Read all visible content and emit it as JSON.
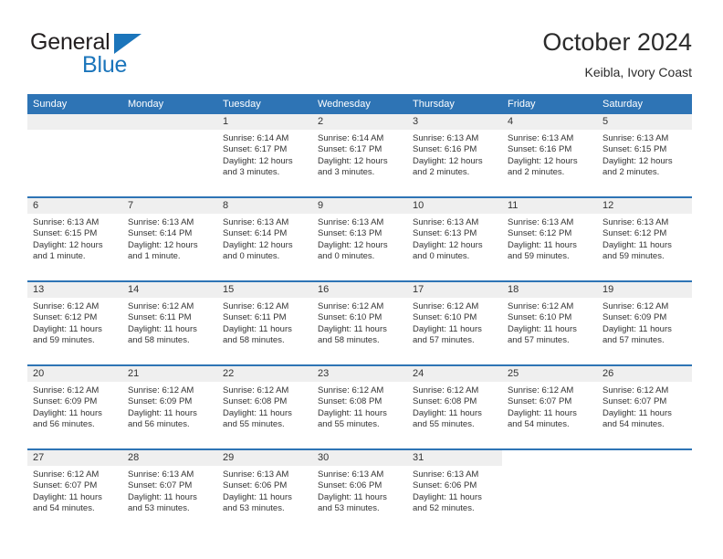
{
  "brand": {
    "name_part1": "General",
    "name_part2": "Blue",
    "triangle_icon": "triangle-icon",
    "accent_color": "#1b75bb"
  },
  "header": {
    "title": "October 2024",
    "subtitle": "Keibla, Ivory Coast"
  },
  "theme": {
    "header_blue": "#2e74b5",
    "daynum_gray": "#efefef",
    "text": "#333333"
  },
  "weekdays": [
    "Sunday",
    "Monday",
    "Tuesday",
    "Wednesday",
    "Thursday",
    "Friday",
    "Saturday"
  ],
  "weeks": [
    {
      "days": [
        {
          "num": "",
          "blank": true,
          "lines": []
        },
        {
          "num": "",
          "blank": true,
          "lines": []
        },
        {
          "num": "1",
          "lines": [
            "Sunrise: 6:14 AM",
            "Sunset: 6:17 PM",
            "Daylight: 12 hours and 3 minutes."
          ]
        },
        {
          "num": "2",
          "lines": [
            "Sunrise: 6:14 AM",
            "Sunset: 6:17 PM",
            "Daylight: 12 hours and 3 minutes."
          ]
        },
        {
          "num": "3",
          "lines": [
            "Sunrise: 6:13 AM",
            "Sunset: 6:16 PM",
            "Daylight: 12 hours and 2 minutes."
          ]
        },
        {
          "num": "4",
          "lines": [
            "Sunrise: 6:13 AM",
            "Sunset: 6:16 PM",
            "Daylight: 12 hours and 2 minutes."
          ]
        },
        {
          "num": "5",
          "lines": [
            "Sunrise: 6:13 AM",
            "Sunset: 6:15 PM",
            "Daylight: 12 hours and 2 minutes."
          ]
        }
      ]
    },
    {
      "days": [
        {
          "num": "6",
          "lines": [
            "Sunrise: 6:13 AM",
            "Sunset: 6:15 PM",
            "Daylight: 12 hours and 1 minute."
          ]
        },
        {
          "num": "7",
          "lines": [
            "Sunrise: 6:13 AM",
            "Sunset: 6:14 PM",
            "Daylight: 12 hours and 1 minute."
          ]
        },
        {
          "num": "8",
          "lines": [
            "Sunrise: 6:13 AM",
            "Sunset: 6:14 PM",
            "Daylight: 12 hours and 0 minutes."
          ]
        },
        {
          "num": "9",
          "lines": [
            "Sunrise: 6:13 AM",
            "Sunset: 6:13 PM",
            "Daylight: 12 hours and 0 minutes."
          ]
        },
        {
          "num": "10",
          "lines": [
            "Sunrise: 6:13 AM",
            "Sunset: 6:13 PM",
            "Daylight: 12 hours and 0 minutes."
          ]
        },
        {
          "num": "11",
          "lines": [
            "Sunrise: 6:13 AM",
            "Sunset: 6:12 PM",
            "Daylight: 11 hours and 59 minutes."
          ]
        },
        {
          "num": "12",
          "lines": [
            "Sunrise: 6:13 AM",
            "Sunset: 6:12 PM",
            "Daylight: 11 hours and 59 minutes."
          ]
        }
      ]
    },
    {
      "days": [
        {
          "num": "13",
          "lines": [
            "Sunrise: 6:12 AM",
            "Sunset: 6:12 PM",
            "Daylight: 11 hours and 59 minutes."
          ]
        },
        {
          "num": "14",
          "lines": [
            "Sunrise: 6:12 AM",
            "Sunset: 6:11 PM",
            "Daylight: 11 hours and 58 minutes."
          ]
        },
        {
          "num": "15",
          "lines": [
            "Sunrise: 6:12 AM",
            "Sunset: 6:11 PM",
            "Daylight: 11 hours and 58 minutes."
          ]
        },
        {
          "num": "16",
          "lines": [
            "Sunrise: 6:12 AM",
            "Sunset: 6:10 PM",
            "Daylight: 11 hours and 58 minutes."
          ]
        },
        {
          "num": "17",
          "lines": [
            "Sunrise: 6:12 AM",
            "Sunset: 6:10 PM",
            "Daylight: 11 hours and 57 minutes."
          ]
        },
        {
          "num": "18",
          "lines": [
            "Sunrise: 6:12 AM",
            "Sunset: 6:10 PM",
            "Daylight: 11 hours and 57 minutes."
          ]
        },
        {
          "num": "19",
          "lines": [
            "Sunrise: 6:12 AM",
            "Sunset: 6:09 PM",
            "Daylight: 11 hours and 57 minutes."
          ]
        }
      ]
    },
    {
      "days": [
        {
          "num": "20",
          "lines": [
            "Sunrise: 6:12 AM",
            "Sunset: 6:09 PM",
            "Daylight: 11 hours and 56 minutes."
          ]
        },
        {
          "num": "21",
          "lines": [
            "Sunrise: 6:12 AM",
            "Sunset: 6:09 PM",
            "Daylight: 11 hours and 56 minutes."
          ]
        },
        {
          "num": "22",
          "lines": [
            "Sunrise: 6:12 AM",
            "Sunset: 6:08 PM",
            "Daylight: 11 hours and 55 minutes."
          ]
        },
        {
          "num": "23",
          "lines": [
            "Sunrise: 6:12 AM",
            "Sunset: 6:08 PM",
            "Daylight: 11 hours and 55 minutes."
          ]
        },
        {
          "num": "24",
          "lines": [
            "Sunrise: 6:12 AM",
            "Sunset: 6:08 PM",
            "Daylight: 11 hours and 55 minutes."
          ]
        },
        {
          "num": "25",
          "lines": [
            "Sunrise: 6:12 AM",
            "Sunset: 6:07 PM",
            "Daylight: 11 hours and 54 minutes."
          ]
        },
        {
          "num": "26",
          "lines": [
            "Sunrise: 6:12 AM",
            "Sunset: 6:07 PM",
            "Daylight: 11 hours and 54 minutes."
          ]
        }
      ]
    },
    {
      "days": [
        {
          "num": "27",
          "lines": [
            "Sunrise: 6:12 AM",
            "Sunset: 6:07 PM",
            "Daylight: 11 hours and 54 minutes."
          ]
        },
        {
          "num": "28",
          "lines": [
            "Sunrise: 6:13 AM",
            "Sunset: 6:07 PM",
            "Daylight: 11 hours and 53 minutes."
          ]
        },
        {
          "num": "29",
          "lines": [
            "Sunrise: 6:13 AM",
            "Sunset: 6:06 PM",
            "Daylight: 11 hours and 53 minutes."
          ]
        },
        {
          "num": "30",
          "lines": [
            "Sunrise: 6:13 AM",
            "Sunset: 6:06 PM",
            "Daylight: 11 hours and 53 minutes."
          ]
        },
        {
          "num": "31",
          "lines": [
            "Sunrise: 6:13 AM",
            "Sunset: 6:06 PM",
            "Daylight: 11 hours and 52 minutes."
          ]
        },
        {
          "num": "",
          "blank": true,
          "lines": []
        },
        {
          "num": "",
          "blank": true,
          "lines": []
        }
      ]
    }
  ]
}
